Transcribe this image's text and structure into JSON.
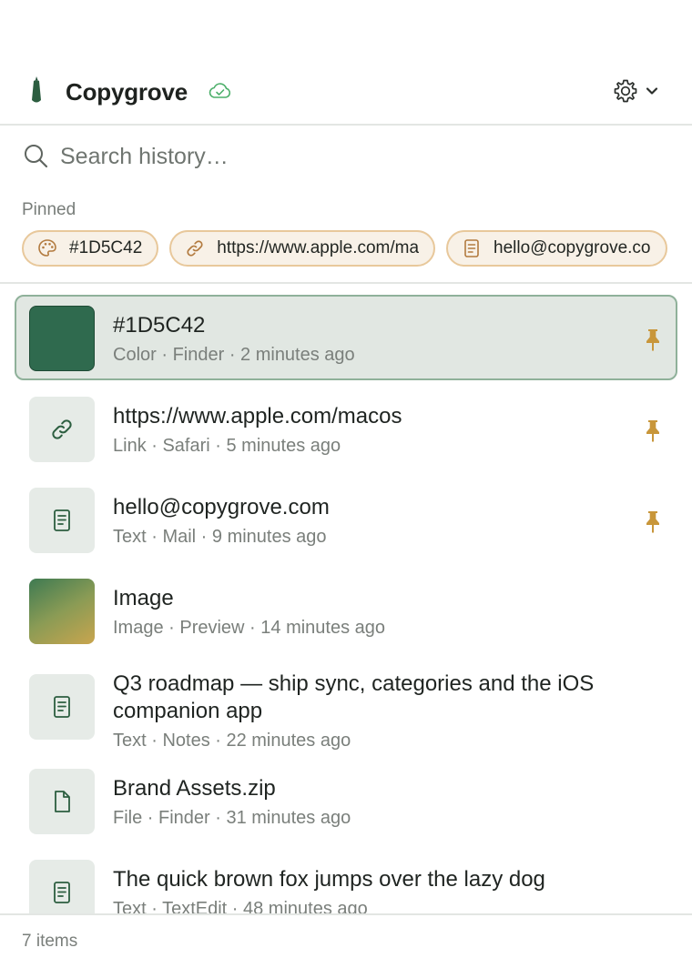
{
  "app": {
    "title": "Copygrove",
    "brand_color": "#2c5e40",
    "pin_color": "#c8963a"
  },
  "search": {
    "placeholder": "Search history…",
    "value": ""
  },
  "pinned": {
    "label": "Pinned",
    "chips": [
      {
        "icon": "palette-icon",
        "text": "#1D5C42"
      },
      {
        "icon": "link-icon",
        "text": "https://www.apple.com/ma"
      },
      {
        "icon": "note-icon",
        "text": "hello@copygrove.co"
      }
    ]
  },
  "items": [
    {
      "kind": "color",
      "icon": "color-swatch",
      "swatch": "#1D5C42",
      "title": "#1D5C42",
      "meta": "Color · Finder · 2 minutes ago",
      "pinned": true,
      "selected": true
    },
    {
      "kind": "link",
      "icon": "link-icon",
      "title": "https://www.apple.com/macos",
      "meta": "Link · Safari · 5 minutes ago",
      "pinned": true,
      "selected": false
    },
    {
      "kind": "text",
      "icon": "note-icon",
      "title": "hello@copygrove.com",
      "meta": "Text · Mail · 9 minutes ago",
      "pinned": true,
      "selected": false
    },
    {
      "kind": "image",
      "icon": "image-thumbnail",
      "title": "Image",
      "meta": "Image · Preview · 14 minutes ago",
      "pinned": false,
      "selected": false
    },
    {
      "kind": "text",
      "icon": "note-icon",
      "title": "Q3 roadmap — ship sync, categories and the iOS companion app",
      "meta": "Text · Notes · 22 minutes ago",
      "pinned": false,
      "selected": false
    },
    {
      "kind": "file",
      "icon": "file-icon",
      "title": "Brand Assets.zip",
      "meta": "File · Finder · 31 minutes ago",
      "pinned": false,
      "selected": false
    },
    {
      "kind": "text",
      "icon": "note-icon",
      "title": "The quick brown fox jumps over the lazy dog",
      "meta": "Text · TextEdit · 48 minutes ago",
      "pinned": false,
      "selected": false
    }
  ],
  "footer": {
    "count": "7 items"
  }
}
